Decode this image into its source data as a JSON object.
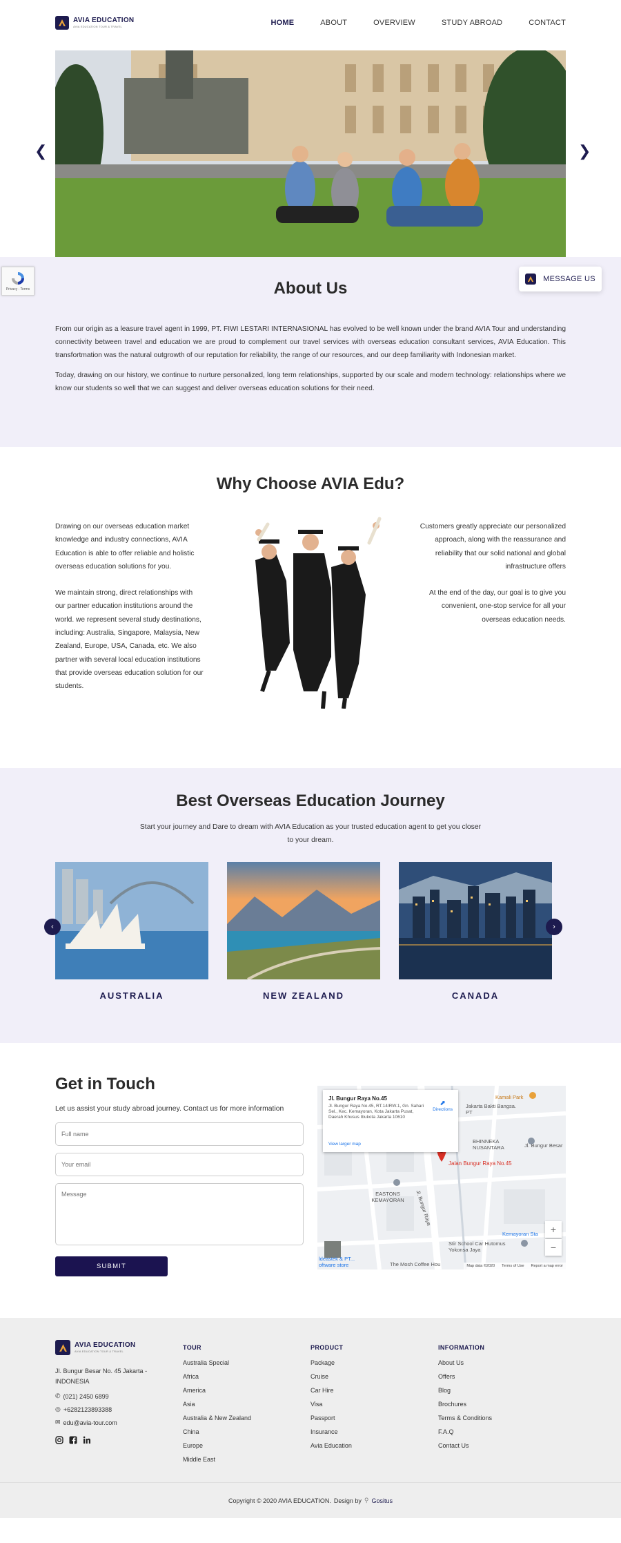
{
  "brand": {
    "name": "AVIA EDUCATION",
    "tagline": "AVIA EDUCATION TOUR & TRAVEL"
  },
  "nav": {
    "items": [
      "HOME",
      "ABOUT",
      "OVERVIEW",
      "STUDY ABROAD",
      "CONTACT"
    ],
    "active": "HOME"
  },
  "hero": {
    "prev": "❮",
    "next": "❯"
  },
  "recaptcha": {
    "label": "Privacy - Terms"
  },
  "message_button": {
    "label": "MESSAGE US"
  },
  "about": {
    "title": "About Us",
    "p1": "From our origin as a leasure travel agent in 1999, PT. FIWI LESTARI INTERNASIONAL has evolved to be well known under the brand AVIA Tour and understanding connectivity between travel and education we are proud to complement our travel services with overseas education consultant services, AVIA Education. This transfortmation was the natural outgrowth of our reputation for reliability, the range of our resources, and our deep familiarity with Indonesian market.",
    "p2": "Today, drawing on our history, we continue to nurture personalized, long term relationships, supported by our scale and modern technology: relationships where we know our students so well that we can suggest and deliver overseas education solutions for their need."
  },
  "why": {
    "title": "Why Choose AVIA Edu?",
    "left_p1": "Drawing on our overseas education market knowledge and industry connections, AVIA Education is able to offer reliable and holistic overseas education solutions for you.",
    "left_p2": "We maintain strong, direct relationships with our partner education institutions around the world. we represent several study destinations, including: Australia, Singapore, Malaysia, New Zealand, Europe, USA, Canada, etc. We also partner with several local education institutions that provide overseas education solution for our students.",
    "right_p1": "Customers greatly appreciate our personalized approach, along with the reassurance and reliability that our solid national and global infrastructure offers",
    "right_p2": "At the end of the day, our goal is to give you convenient, one-stop service for all your overseas education needs."
  },
  "journey": {
    "title": "Best Overseas Education Journey",
    "subtitle": "Start your journey and Dare to dream with AVIA Education as your trusted education agent to get you closer to your dream.",
    "destinations": [
      "AUSTRALIA",
      "NEW ZEALAND",
      "CANADA"
    ],
    "prev": "‹",
    "next": "›"
  },
  "contact": {
    "title": "Get in Touch",
    "subtitle": "Let us assist your study abroad journey. Contact us for more information",
    "name_placeholder": "Full name",
    "email_placeholder": "Your email",
    "message_placeholder": "Message",
    "submit": "SUBMIT"
  },
  "map": {
    "place": "Jl. Bungur Raya No.45",
    "address": "Jl. Bungur Raya No.45, RT.14/RW.1, Gn. Sahari Sel., Kec. Kemayoran, Kota Jakarta Pusat, Daerah Khusus Ibukota Jakarta 10610",
    "larger_map": "View larger map",
    "directions": "Directions",
    "pin_label": "Jalan Bungur Raya No.45",
    "labels": [
      "Kamali Park",
      "Jakarta Bakti Bangsa. PT",
      "BHINNEKA NUSANTARA",
      "Jl. Bungur Besar",
      "EASTONS KEMAYORAN",
      "Jl. Bungur Raya",
      "Kemayoran Sta",
      "Stir School Car Hutomus Yokonsa Jaya",
      "The Mosh Coffee Hou",
      "ldeastek & PT...",
      "oftware store"
    ],
    "zoom_in": "+",
    "zoom_out": "−",
    "footer": [
      "Map data ©2020",
      "Terms of Use",
      "Report a map error"
    ]
  },
  "footer": {
    "address": "Jl. Bungur Besar No. 45 Jakarta - INDONESIA",
    "phone": "(021) 2450 6899",
    "whatsapp": "+6282123893388",
    "email": "edu@avia-tour.com",
    "tour": {
      "title": "TOUR",
      "items": [
        "Australia Special",
        "Africa",
        "America",
        "Asia",
        "Australia & New Zealand",
        "China",
        "Europe",
        "Middle East"
      ]
    },
    "product": {
      "title": "PRODUCT",
      "items": [
        "Package",
        "Cruise",
        "Car Hire",
        "Visa",
        "Passport",
        "Insurance",
        "Avia Education"
      ]
    },
    "information": {
      "title": "INFORMATION",
      "items": [
        "About Us",
        "Offers",
        "Blog",
        "Brochures",
        "Terms & Conditions",
        "F.A.Q",
        "Contact Us"
      ]
    }
  },
  "copyright": {
    "text": "Copyright © 2020 AVIA EDUCATION.",
    "design_by": "Design by",
    "designer": "Gositus"
  },
  "colors": {
    "primary": "#1d1b4f",
    "lavender": "#f1eff9",
    "footer_bg": "#eeeeee",
    "accent_orange": "#e8a13a"
  }
}
